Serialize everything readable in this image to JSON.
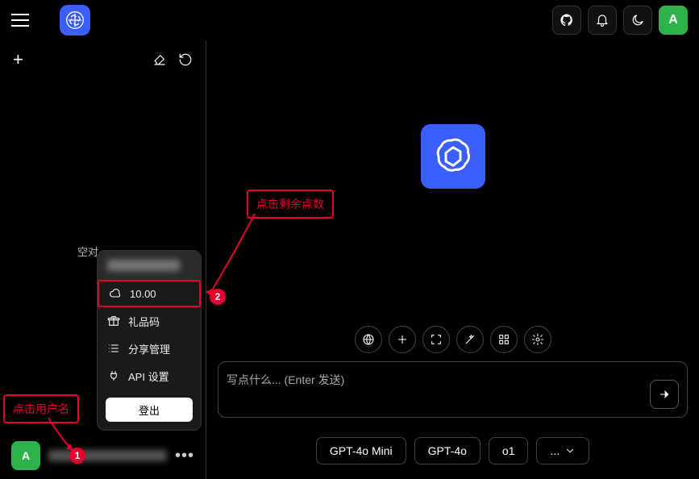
{
  "header": {
    "avatar_initial": "A"
  },
  "sidebar": {
    "empty_label": "空对",
    "footer_avatar_initial": "A"
  },
  "popup": {
    "points_value": "10.00",
    "items": [
      {
        "label": "礼品码"
      },
      {
        "label": "分享管理"
      },
      {
        "label": "API 设置"
      }
    ],
    "logout_label": "登出"
  },
  "input": {
    "placeholder": "写点什么... (Enter 发送)"
  },
  "models": [
    {
      "label": "GPT-4o Mini"
    },
    {
      "label": "GPT-4o"
    },
    {
      "label": "o1"
    },
    {
      "label": "..."
    }
  ],
  "annotations": {
    "callout1": {
      "text": "点击剩余点数",
      "num": "2"
    },
    "callout2": {
      "text": "点击用户名",
      "num": "1"
    }
  }
}
